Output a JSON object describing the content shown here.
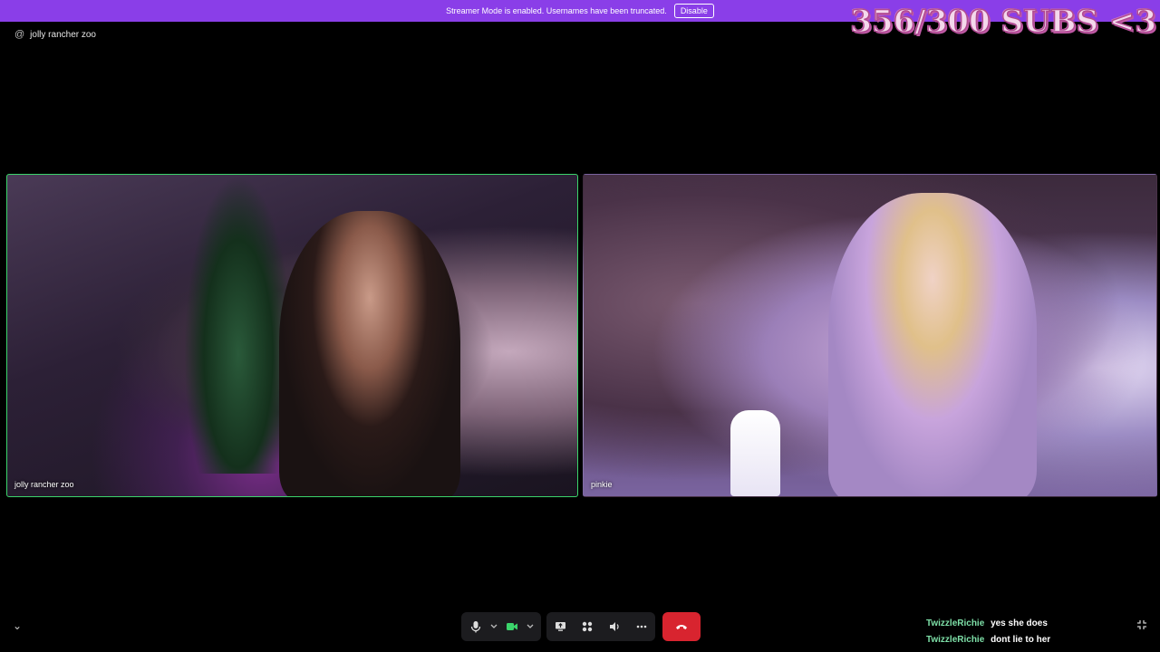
{
  "banner": {
    "message": "Streamer Mode is enabled. Usernames have been truncated.",
    "disable_label": "Disable"
  },
  "overlay": {
    "subs_text": "356/300 SUBS <3"
  },
  "channel": {
    "at_symbol": "@",
    "name": "jolly rancher zoo"
  },
  "tiles": [
    {
      "label": "jolly rancher zoo",
      "speaking": true
    },
    {
      "label": "pinkie",
      "speaking": false
    }
  ],
  "controls": {
    "icons": [
      "microphone-icon",
      "chevron-down-icon",
      "camera-icon",
      "chevron-down-icon",
      "screen-share-icon",
      "activities-icon",
      "soundboard-icon",
      "more-icon",
      "hang-up-icon"
    ]
  },
  "chat": [
    {
      "user": "TwizzleRichie",
      "text": "yes she does"
    },
    {
      "user": "TwizzleRichie",
      "text": "dont lie to her"
    }
  ],
  "colors": {
    "banner": "#8a3ee8",
    "speaking_border": "#3bd46b",
    "hangup": "#d8242f",
    "chat_user": "#7ee0a8"
  }
}
